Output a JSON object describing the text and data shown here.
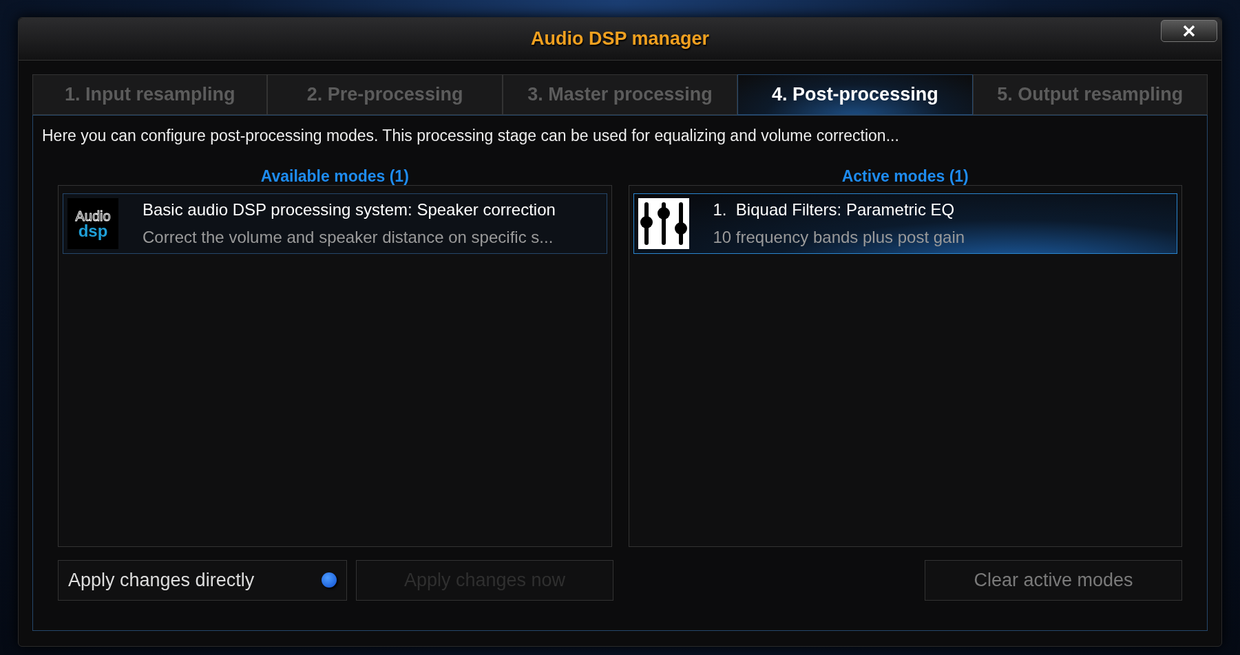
{
  "dialog": {
    "title": "Audio DSP manager"
  },
  "tabs": [
    {
      "label": "1. Input resampling",
      "selected": false
    },
    {
      "label": "2. Pre-processing",
      "selected": false
    },
    {
      "label": "3. Master processing",
      "selected": false
    },
    {
      "label": "4. Post-processing",
      "selected": true
    },
    {
      "label": "5. Output resampling",
      "selected": false
    }
  ],
  "description": "Here you can configure post-processing modes. This processing stage can be used for equalizing and volume correction...",
  "panels": [
    {
      "heading": "Available modes (1)",
      "items": [
        {
          "kind": "logo",
          "logo_text": [
            "Audio",
            "dsp"
          ],
          "title": "Basic audio DSP processing system: Speaker correction",
          "subtitle": "Correct the volume and speaker distance on specific s...",
          "selected": false
        }
      ]
    },
    {
      "heading": "Active modes (1)",
      "items": [
        {
          "kind": "equalizer",
          "number": "1.",
          "title": "Biquad Filters: Parametric EQ",
          "subtitle": "10 frequency bands plus post gain",
          "selected": true
        }
      ]
    }
  ],
  "apply_toggle": {
    "label": "Apply changes directly",
    "on": true
  },
  "buttons": [
    {
      "label": "Apply changes now",
      "disabled": true
    },
    {
      "label": "Clear active modes",
      "disabled": false
    }
  ]
}
